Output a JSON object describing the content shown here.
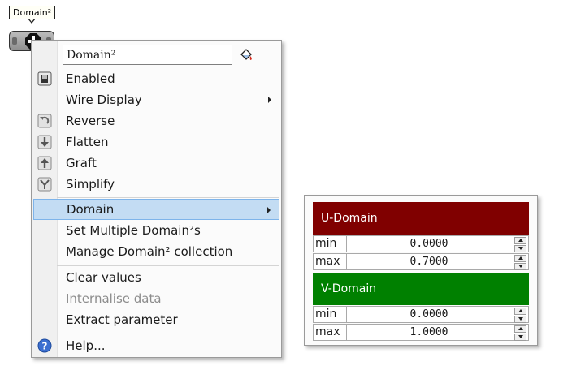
{
  "tooltip": {
    "text": "Domain²"
  },
  "menu": {
    "name_field": "Domain²",
    "items": [
      {
        "label": "Enabled",
        "icon": "enabled-checkbox-icon"
      },
      {
        "label": "Wire Display",
        "submenu": true
      },
      {
        "label": "Reverse",
        "icon": "reverse-icon"
      },
      {
        "label": "Flatten",
        "icon": "flatten-icon"
      },
      {
        "label": "Graft",
        "icon": "graft-icon"
      },
      {
        "label": "Simplify",
        "icon": "simplify-icon"
      },
      {
        "label": "Domain",
        "submenu": true,
        "highlighted": true
      },
      {
        "label": "Set Multiple Domain²s"
      },
      {
        "label": "Manage Domain² collection"
      },
      {
        "label": "Clear values"
      },
      {
        "label": "Internalise data",
        "disabled": true
      },
      {
        "label": "Extract parameter"
      },
      {
        "label": "Help...",
        "icon": "help-icon"
      }
    ]
  },
  "domain_panel": {
    "u": {
      "title": "U-Domain",
      "color": "#800000",
      "min_label": "min",
      "min_value": "0.0000",
      "max_label": "max",
      "max_value": "0.7000"
    },
    "v": {
      "title": "V-Domain",
      "color": "#008000",
      "min_label": "min",
      "min_value": "0.0000",
      "max_label": "max",
      "max_value": "1.0000"
    }
  },
  "colors": {
    "highlight": "#c3dcf3",
    "highlight_border": "#7eb4ea",
    "help_blue": "#3c6fd0"
  }
}
